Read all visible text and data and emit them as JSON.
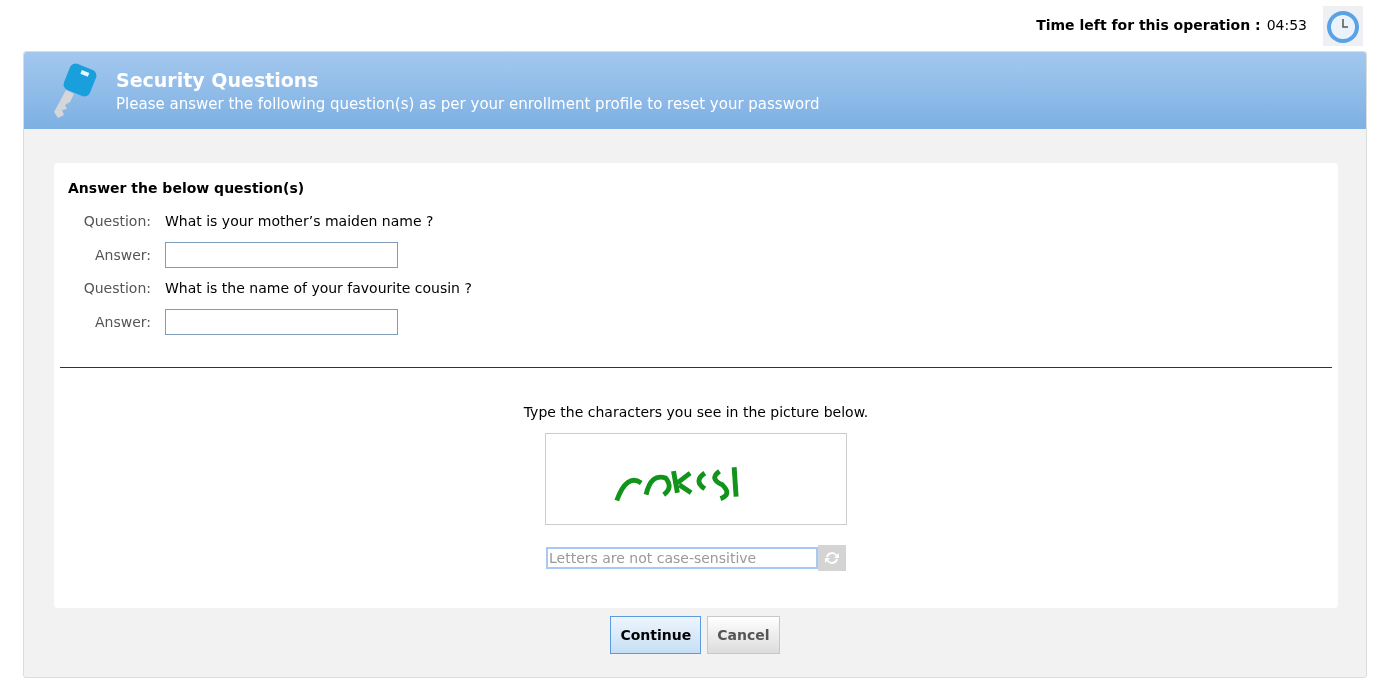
{
  "timer": {
    "label": "Time left for this operation :",
    "value": "04:53"
  },
  "header": {
    "title": "Security Questions",
    "subtitle": "Please answer the following question(s) as per your enrollment profile to reset your password"
  },
  "form": {
    "heading": "Answer the below question(s)",
    "questions": [
      {
        "question_label": "Question:",
        "question": "What is your mother’s maiden name ?",
        "answer_label": "Answer:"
      },
      {
        "question_label": "Question:",
        "question": "What is the name of your favourite cousin ?",
        "answer_label": "Answer:"
      }
    ],
    "captcha": {
      "instruction": "Type the characters you see in the picture below.",
      "placeholder": "Letters are not case-sensitive"
    }
  },
  "buttons": [
    {
      "label": "Continue",
      "kind": "primary"
    },
    {
      "label": "Cancel",
      "kind": "secondary"
    }
  ]
}
